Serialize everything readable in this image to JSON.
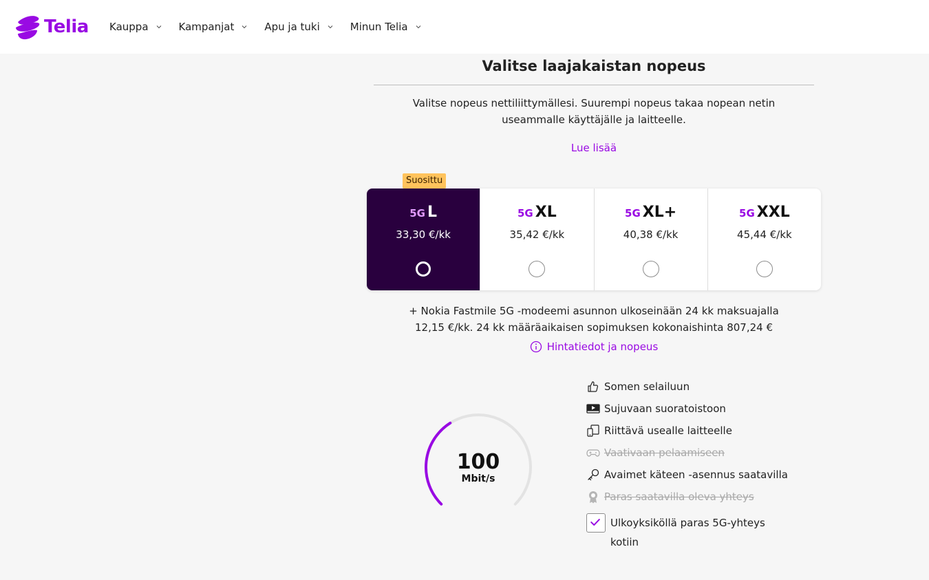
{
  "brand": {
    "name": "Telia",
    "color": "#990ae3",
    "icon": "telia-logo-icon"
  },
  "nav": {
    "items": [
      {
        "label": "Kauppa",
        "icon": "chevron-down-icon"
      },
      {
        "label": "Kampanjat",
        "icon": "chevron-down-icon"
      },
      {
        "label": "Apu ja tuki",
        "icon": "chevron-down-icon"
      },
      {
        "label": "Minun Telia",
        "icon": "chevron-down-icon"
      }
    ]
  },
  "section": {
    "title": "Valitse laajakaistan nopeus",
    "intro": "Valitse nopeus nettiliittymällesi. Suurempi nopeus takaa nopean netin useammalle käyttäjälle ja laitteelle.",
    "read_more": "Lue lisää"
  },
  "badge": {
    "label": "Suosittu",
    "color": "#ffc35c"
  },
  "plans": [
    {
      "tech": "5G",
      "size": "L",
      "price": "33,30 €/kk",
      "selected": true
    },
    {
      "tech": "5G",
      "size": "XL",
      "price": "35,42 €/kk",
      "selected": false
    },
    {
      "tech": "5G",
      "size": "XL+",
      "price": "40,38 €/kk",
      "selected": false
    },
    {
      "tech": "5G",
      "size": "XXL",
      "price": "45,44 €/kk",
      "selected": false
    }
  ],
  "active_plan_color": "#29003e",
  "modem_text": "+ Nokia Fastmile 5G -modeemi asunnon ulkoseinään 24 kk maksuajalla 12,15 €/kk. 24 kk määräaikaisen sopimuksen kokonaishinta 807,24 €",
  "price_info": {
    "label": "Hintatiedot ja nopeus",
    "icon": "info-icon"
  },
  "speed": {
    "value": "100",
    "unit": "Mbit/s",
    "fill_fraction": 0.38
  },
  "features": [
    {
      "label": "Somen selailuun",
      "icon": "thumbs-up-icon",
      "available": true
    },
    {
      "label": "Sujuvaan suoratoistoon",
      "icon": "video-play-icon",
      "available": true
    },
    {
      "label": "Riittävä usealle laitteelle",
      "icon": "devices-icon",
      "available": true
    },
    {
      "label": "Vaativaan pelaamiseen",
      "icon": "gamepad-icon",
      "available": false
    },
    {
      "label": "Avaimet käteen -asennus saatavilla",
      "icon": "key-icon",
      "available": true
    },
    {
      "label": "Paras saatavilla oleva yhteys",
      "icon": "award-icon",
      "available": false
    }
  ],
  "outdoor_option": {
    "label": "Ulkoyksiköllä paras 5G-yhteys kotiin",
    "checked": true
  }
}
